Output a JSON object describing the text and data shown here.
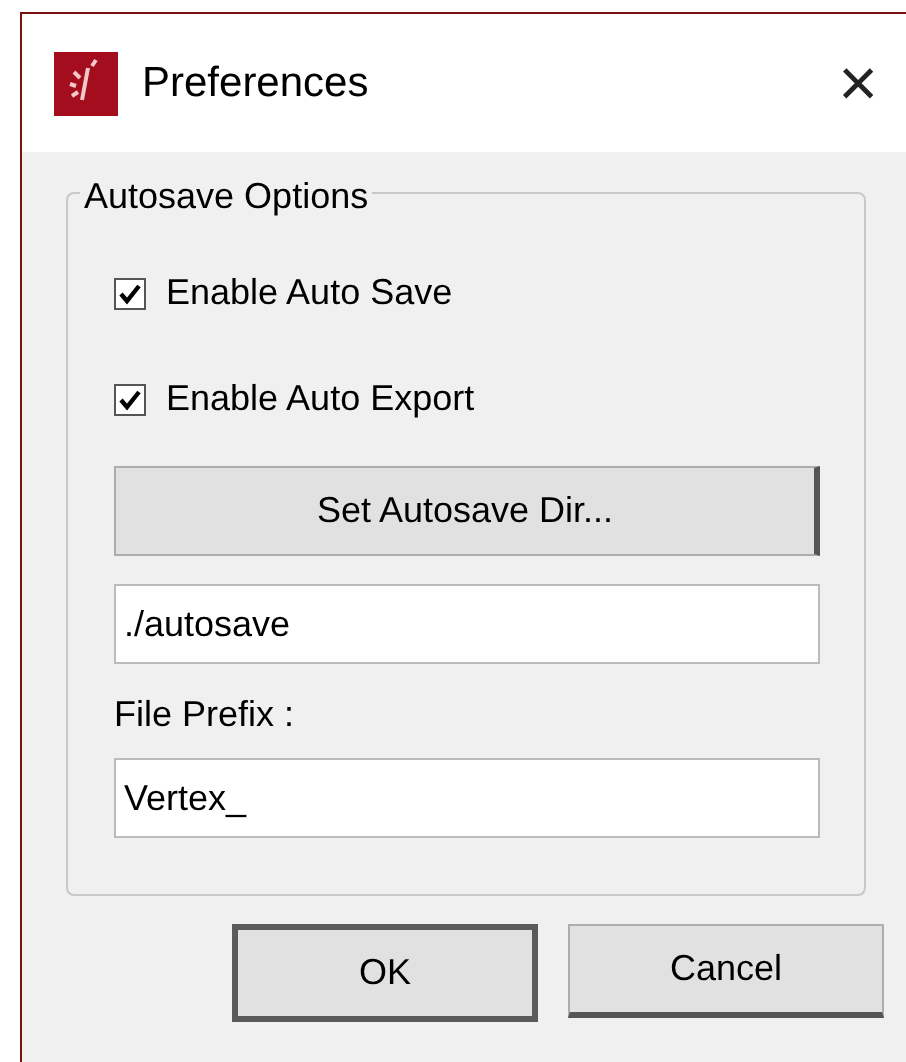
{
  "window": {
    "title": "Preferences",
    "close": "×"
  },
  "group": {
    "title": "Autosave Options"
  },
  "checkboxes": [
    {
      "label": "Enable Auto Save",
      "checked": true
    },
    {
      "label": "Enable Auto Export",
      "checked": true
    }
  ],
  "dir_button": "Set Autosave Dir...",
  "dir_field": {
    "value": "./autosave"
  },
  "prefix_label": "File Prefix :",
  "prefix_field": {
    "value": "Vertex_"
  },
  "buttons": [
    {
      "label": "OK",
      "default": true
    },
    {
      "label": "Cancel",
      "default": false
    }
  ]
}
